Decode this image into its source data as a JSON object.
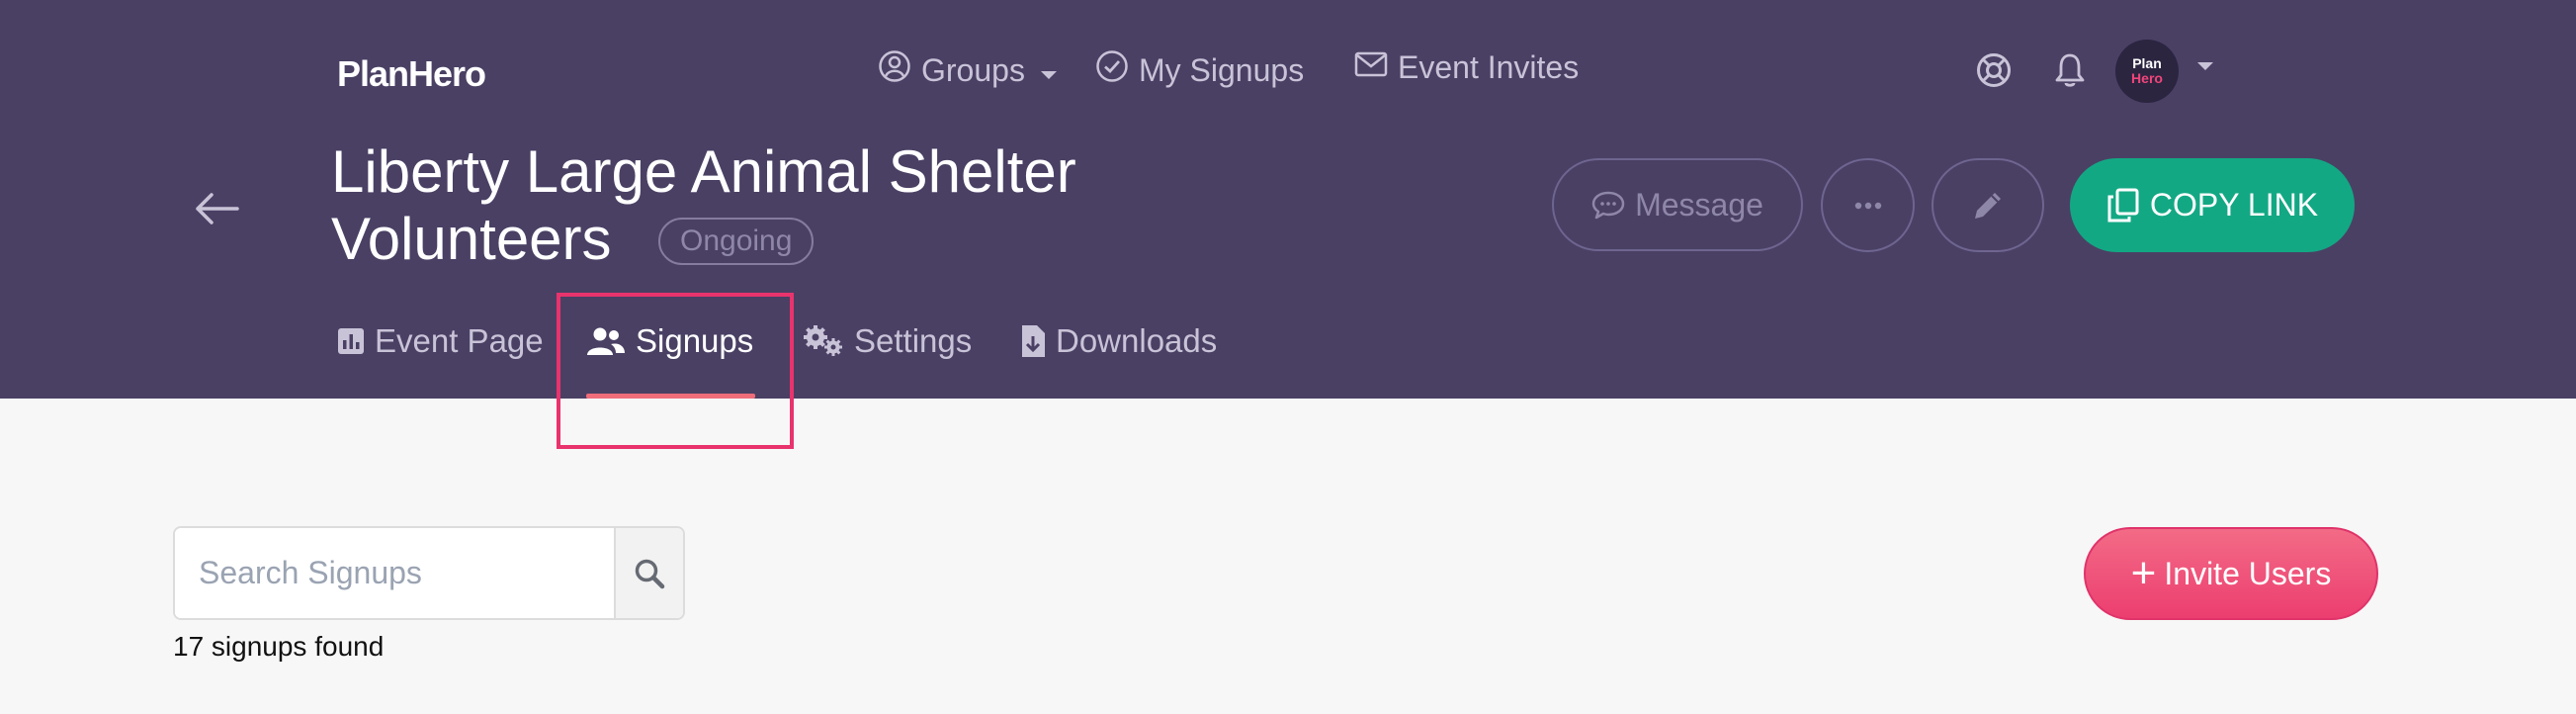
{
  "header": {
    "logo": "PlanHero",
    "nav": {
      "groups": "Groups",
      "my_signups": "My Signups",
      "event_invites": "Event Invites"
    },
    "avatar": {
      "line1": "Plan",
      "line2": "Hero"
    }
  },
  "event": {
    "title_line1": "Liberty Large Animal Shelter",
    "title_line2": "Volunteers",
    "status": "Ongoing"
  },
  "actions": {
    "message": "Message",
    "copy_link": "COPY LINK"
  },
  "tabs": [
    {
      "label": "Event Page"
    },
    {
      "label": "Signups"
    },
    {
      "label": "Settings"
    },
    {
      "label": "Downloads"
    }
  ],
  "search": {
    "placeholder": "Search Signups"
  },
  "results": {
    "count_text": "17 signups found"
  },
  "invite": {
    "label": "Invite Users"
  },
  "colors": {
    "header_bg": "#4a4064",
    "copy_link": "#13a884",
    "invite": "#ec3e70",
    "highlight": "#e8336d"
  }
}
